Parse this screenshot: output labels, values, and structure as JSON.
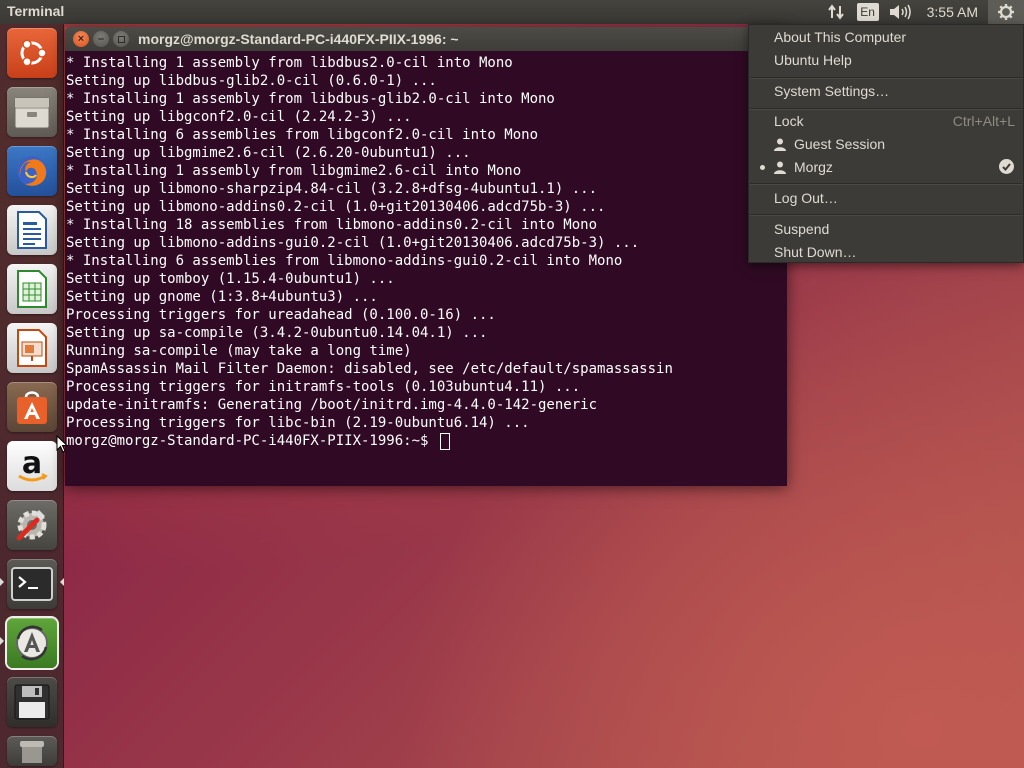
{
  "panel": {
    "title": "Terminal",
    "keyboard_layout": "En",
    "clock": "3:55 AM",
    "icons": [
      "network-icon",
      "keyboard-layout-indicator",
      "volume-icon",
      "gear-icon"
    ]
  },
  "launcher": {
    "items": [
      "ubuntu-dash-icon",
      "files-icon",
      "firefox-icon",
      "libreoffice-writer-icon",
      "libreoffice-calc-icon",
      "libreoffice-impress-icon",
      "software-center-icon",
      "amazon-icon",
      "system-settings-icon",
      "terminal-icon",
      "software-updater-icon",
      "save-disk-icon",
      "trash-icon"
    ]
  },
  "terminal": {
    "title": "morgz@morgz-Standard-PC-i440FX-PIIX-1996: ~",
    "lines": [
      "* Installing 1 assembly from libdbus2.0-cil into Mono",
      "Setting up libdbus-glib2.0-cil (0.6.0-1) ...",
      "* Installing 1 assembly from libdbus-glib2.0-cil into Mono",
      "Setting up libgconf2.0-cil (2.24.2-3) ...",
      "* Installing 6 assemblies from libgconf2.0-cil into Mono",
      "Setting up libgmime2.6-cil (2.6.20-0ubuntu1) ...",
      "* Installing 1 assembly from libgmime2.6-cil into Mono",
      "Setting up libmono-sharpzip4.84-cil (3.2.8+dfsg-4ubuntu1.1) ...",
      "Setting up libmono-addins0.2-cil (1.0+git20130406.adcd75b-3) ...",
      "* Installing 18 assemblies from libmono-addins0.2-cil into Mono",
      "Setting up libmono-addins-gui0.2-cil (1.0+git20130406.adcd75b-3) ...",
      "* Installing 6 assemblies from libmono-addins-gui0.2-cil into Mono",
      "Setting up tomboy (1.15.4-0ubuntu1) ...",
      "Setting up gnome (1:3.8+4ubuntu3) ...",
      "Processing triggers for ureadahead (0.100.0-16) ...",
      "Setting up sa-compile (3.4.2-0ubuntu0.14.04.1) ...",
      "Running sa-compile (may take a long time)",
      "SpamAssassin Mail Filter Daemon: disabled, see /etc/default/spamassassin",
      "Processing triggers for initramfs-tools (0.103ubuntu4.11) ...",
      "update-initramfs: Generating /boot/initrd.img-4.4.0-142-generic",
      "Processing triggers for libc-bin (2.19-0ubuntu6.14) ..."
    ],
    "prompt": "morgz@morgz-Standard-PC-i440FX-PIIX-1996:~$ "
  },
  "session_menu": {
    "about": "About This Computer",
    "help": "Ubuntu Help",
    "system_settings": "System Settings…",
    "lock": "Lock",
    "lock_shortcut": "Ctrl+Alt+L",
    "guest": "Guest Session",
    "user": "Morgz",
    "logout": "Log Out…",
    "suspend": "Suspend",
    "shutdown": "Shut Down…"
  },
  "colors": {
    "terminal_bg": "#300a24",
    "panel_bg": "#3c3b37",
    "close_button": "#e25b28",
    "accent_orange": "#dd4814"
  }
}
